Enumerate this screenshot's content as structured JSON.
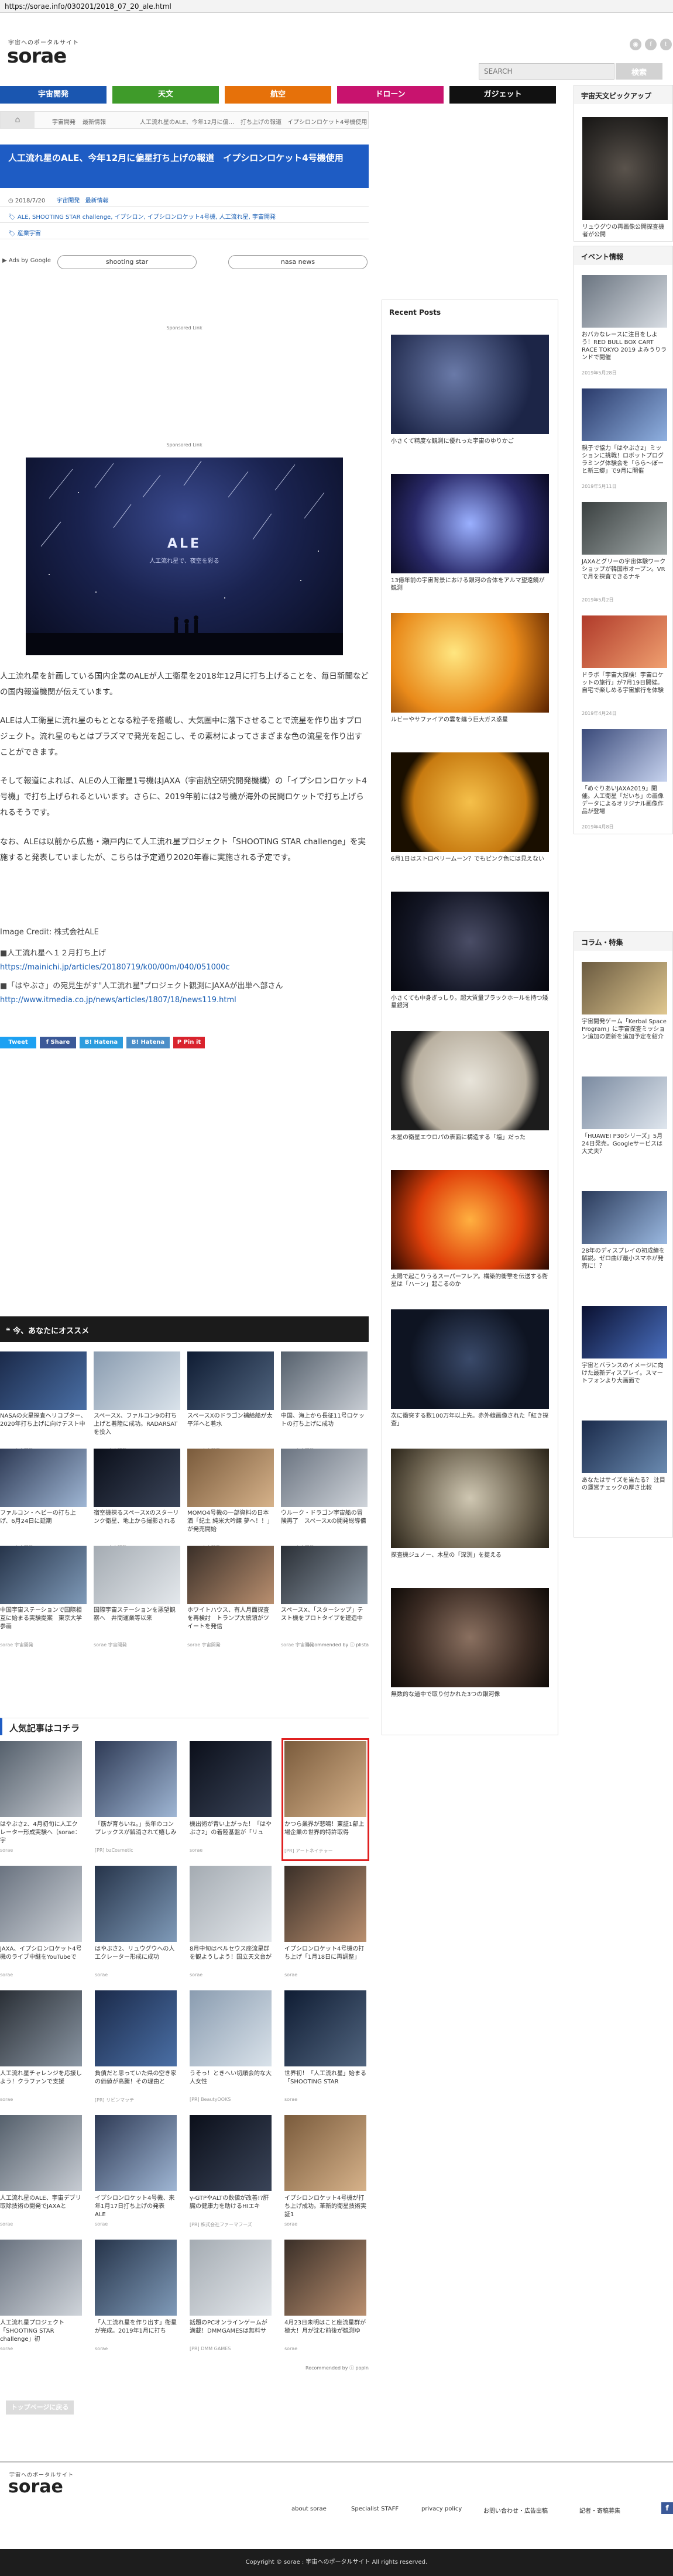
{
  "url": "https://sorae.info/030201/2018_07_20_ale.html",
  "header": {
    "logo_sub": "宇宙へのポータルサイト",
    "logo": "sorae",
    "search_placeholder": "SEARCH",
    "search_button": "検索"
  },
  "nav": {
    "tabs": [
      {
        "label": "宇宙開発",
        "color": "#1a56b0"
      },
      {
        "label": "天文",
        "color": "#3f9b2a"
      },
      {
        "label": "航空",
        "color": "#e6710a"
      },
      {
        "label": "ドローン",
        "color": "#c8136e"
      },
      {
        "label": "ガジェット",
        "color": "#111111"
      }
    ]
  },
  "breadcrumb": {
    "home": "⌂",
    "items": [
      "宇宙開発",
      "最新情報",
      "人工流れ星のALE、今年12月に偏…",
      "打ち上げの報道　イプシロンロケット4号機使用"
    ]
  },
  "article": {
    "title": "人工流れ星のALE、今年12月に偏星打ち上げの報道　イプシロンロケット4号機使用",
    "date": "2018/7/20",
    "categories": [
      "宇宙開発",
      "最新情報"
    ],
    "tags": [
      "ALE",
      "SHOOTING STAR challenge",
      "イプシロン",
      "イプシロンロケット4号機",
      "人工流れ星",
      "宇宙開発"
    ],
    "tag_extra": "産業宇宙",
    "ads_by_google": "Ads by Google",
    "ad_pills": [
      "shooting star",
      "nasa news"
    ],
    "sponsored": "Sponsored Link",
    "hero_title": "ALE",
    "hero_sub": "人工流れ星で、夜空を彩る",
    "paragraphs": {
      "p1": "人工流れ星を計画している国内企業のALEが人工衛星を2018年12月に打ち上げることを、毎日新聞などの国内報道機関が伝えています。",
      "p2": "ALEは人工衛星に流れ星のもととなる粒子を搭載し、大気圏中に落下させることで流星を作り出すプロジェクト。流れ星のもとはプラズマで発光を起こし、その素材によってさまざまな色の流星を作り出すことができます。",
      "p3": "そして報道によれば、ALEの人工衛星1号機はJAXA（宇宙航空研究開発機構）の「イプシロンロケット4号機」で打ち上げられるといいます。さらに、2019年前には2号機が海外の民間ロケットで打ち上げられるそうです。",
      "p4": "なお、ALEは以前から広島・瀬戸内にて人工流れ星プロジェクト「SHOOTING STAR challenge」を実施すると発表していましたが、こちらは予定通り2020年春に実施される予定です。"
    },
    "credit": "Image Credit: 株式会社ALE",
    "source_lines": [
      "■人工流れ星へ１２月打ち上げ",
      "https://mainichi.jp/articles/20180719/k00/00m/040/051000c",
      "■「はやぶさ」の宛見生がす\"人工流れ星\"プロジェクト観測にJAXAが出単へ部さん",
      "http://www.itmedia.co.jp/news/articles/1807/18/news119.html"
    ],
    "share": [
      {
        "label": "Tweet",
        "color": "#1da1f2"
      },
      {
        "label": "f Share",
        "color": "#3b5998"
      },
      {
        "label": "B! Hatena",
        "color": "#2c9cde"
      },
      {
        "label": "B! Hatena",
        "color": "#4b8ec8"
      },
      {
        "label": "P Pin it",
        "color": "#d9232d"
      }
    ]
  },
  "recommend": {
    "title": "今、あなたにオススメ",
    "items": [
      {
        "caption": "NASAの火星探査ヘリコプター、2020年打ち上げに向けテスト中",
        "source": "sorae 宇宙開発"
      },
      {
        "caption": "スペースX、ファルコン9の打ち上げと着陸に成功。RADARSATを投入",
        "source": "sorae 宇宙開発"
      },
      {
        "caption": "スペースXのドラゴン補給船が太平洋へと着水",
        "source": "sorae 宇宙開発"
      },
      {
        "caption": "中国、海上から長征11号ロケットの打ち上げに成功",
        "source": "sorae 宇宙開発"
      },
      {
        "caption": "ファルコン・ヘビーの打ち上げ、6月24日に延期",
        "source": "sorae 宇宙開発"
      },
      {
        "caption": "宿空機探るスペースXのスターリンク衛星、地上から撮影される",
        "source": "sorae 宇宙開発"
      },
      {
        "caption": "MOMO4号機の一部資料の日本酒「紀土 純米大吟醸 夢ヘ！！」が発売開始",
        "source": "sorae 宇宙開発"
      },
      {
        "caption": "ウルーク・ドラゴン宇宙船の冒険再了　スペースXの開発総導備",
        "source": "sorae 宇宙開発"
      },
      {
        "caption": "中国宇宙ステーションで国際相互に始まる実験提案　東京大学参画",
        "source": "sorae 宇宙開発"
      },
      {
        "caption": "国際宇宙ステーションを悪望観察へ　井間運業等以来",
        "source": "sorae 宇宙開発"
      },
      {
        "caption": "ホワイトハウス、有人月面探査を再検討　トランプ大統領がツイートを発信",
        "source": "sorae 宇宙開発"
      },
      {
        "caption": "スペースX、「スターシップ」テスト機をプロトタイプを建造中",
        "source": "sorae 宇宙開発"
      }
    ],
    "powered": "Recommended by ⓘ plista"
  },
  "popular": {
    "title": "人気記事はコチラ",
    "items": [
      {
        "caption": "はやぶさ2、4月初旬に人工クレーター形成実験へ（sorae：宇",
        "source": "sorae"
      },
      {
        "caption": "「筋が育ちいね。」長年のコンプレックスが解消されて嬉しみ",
        "source": "[PR] bzCosmetic"
      },
      {
        "caption": "機出術が青い上がった！「はやぶさ2」の着陸基盤が「リュ",
        "source": "sorae"
      },
      {
        "caption": "かつら業界が悲鳴！東証1部上場企業の世界的特許取得",
        "source": "[PR] アートネイチャー"
      },
      {
        "caption": "JAXA、イプシロンロケット4号機のライブ中継をYouTubeで",
        "source": "sorae"
      },
      {
        "caption": "はやぶさ2、リュウグウへの人工クレーター形成に成功",
        "source": "sorae"
      },
      {
        "caption": "8月中旬はペルセウス座流星群を観ようしよう！国立天文台が",
        "source": "sorae"
      },
      {
        "caption": "イプシロンロケット4号機の打ち上げ「1月18日に再調整」",
        "source": "sorae"
      },
      {
        "caption": "人工流れ星チャレンジを応援しよう！クラファンで支援",
        "source": "sorae"
      },
      {
        "caption": "負債だと思っていた県の空き家の価値が高騰！その理由と",
        "source": "[PR] リビンマッチ"
      },
      {
        "caption": "うそっ！ときへい切順会的な大人女性",
        "source": "[PR] BeautyOOKS"
      },
      {
        "caption": "世界初！「人工流れ星」始まる「SHOOTING STAR",
        "source": "sorae"
      },
      {
        "caption": "人工流れ星のALE、宇宙デブリ取除技術の開発でJAXAと",
        "source": "sorae"
      },
      {
        "caption": "イプシロンロケット4号機、来年1月17日打ち上げの発表 ALE",
        "source": "sorae"
      },
      {
        "caption": "γ-GTPやALTの数値が改善!?肝臓の健康力を助けるHIエキ",
        "source": "[PR] 株式会社ファーマフーズ"
      },
      {
        "caption": "イプシロンロケット4号機が打ち上げ成功。革新的衛星技術実証1",
        "source": "sorae"
      },
      {
        "caption": "人工流れ星プロジェクト「SHOOTING STAR challenge」初",
        "source": "sorae"
      },
      {
        "caption": "「人工流れ星を作り出す」衛星が完成。2019年1月に打ち",
        "source": "sorae"
      },
      {
        "caption": "話題のPCオンラインゲームが満載！DMMGAMESは無料サ",
        "source": "[PR] DMM GAMES"
      },
      {
        "caption": "4月23日未明はこと座流星群が極大！月が沈む前後が観測ゆ",
        "source": "sorae"
      }
    ],
    "powered": "Recommended by ⓘ popIn"
  },
  "back_to_top": "トップページに戻る",
  "sidebar_mid": {
    "title": "Recent Posts",
    "items": [
      {
        "caption": "小さくて精度な観測に優れった宇宙のゆりかご"
      },
      {
        "caption": "13億年前の宇宙背景における銀河の合体をアルマ望遠鏡が観測"
      },
      {
        "caption": "ルビーやサファイアの雲を纏う巨大ガス惑星"
      },
      {
        "caption": "6月1日はストロベリームーン？でもピンク色には見えない"
      },
      {
        "caption": "小さくても中身ぎっしり。超大質量ブラックホールを持つ矮星銀河"
      },
      {
        "caption": "木星の衛星エウロパの表面に構造する「塩」だった"
      },
      {
        "caption": "太陽で起こりうるスーパーフレア。構築的衝撃を伝送する衛星は「ハーン」起こるのか"
      },
      {
        "caption": "次に衝突する数100万年以上先。赤外線画像された「紅き探查」"
      },
      {
        "caption": "探査機ジュノー、木星の「深渕」を捉える"
      },
      {
        "caption": "無数的な過中で取り付かれた3つの銀河像"
      }
    ]
  },
  "sidebar_right": {
    "pickup_title": "宇宙天文ピックアップ",
    "pickup_caption": "リュウグウの再画像公開探査機者が公開",
    "events_title": "イベント情報",
    "events": [
      {
        "caption": "おバカなレースに注目をしよう！RED BULL BOX CART RACE TOKYO 2019 よみうりランドで開催",
        "date": "2019年5月28日"
      },
      {
        "caption": "親子で協力「はやぶさ2」ミッションに挑戦！ロボットプログラミング体験会を「らら～ぽーと新三郷」で9月に開催",
        "date": "2019年5月11日"
      },
      {
        "caption": "JAXAとグリーの宇宙体験ワークショップが韓国市オープン。VRで月を探査できるナキ",
        "date": "2019年5月2日"
      },
      {
        "caption": "ドラボ「宇宙大探検！宇宙ロケットの旅行」が7月19日開催。自宅で楽しめる宇宙旅行を体験",
        "date": "2019年4月24日"
      },
      {
        "caption": "「めぐりあいJAXA2019」開催。人工衛星「だいち」の画像データによるオリジナル画像作品が登場",
        "date": "2019年4月8日"
      }
    ],
    "column_title": "コラム・特集",
    "columns": [
      {
        "caption": "宇宙開発ゲーム「Kerbal Space Program」に宇宙探査ミッション追加の更新を追加予定を紹介"
      },
      {
        "caption": "「HUAWEI P30シリーズ」5月24日発売。Googleサービスは大丈夫？"
      },
      {
        "caption": "28年のディスプレイの初成績を解説。ゼロ曲げ最小スマホが発売に！？"
      },
      {
        "caption": "宇宙とバランスのイメージに向けた最新ディスプレイ。スマートフォンより大画面で"
      },
      {
        "caption": "あなたはサイズを当たる？ 注目の運営チェックの厚さ比較"
      }
    ]
  },
  "footer": {
    "logo_sub": "宇宙へのポータルサイト",
    "logo": "sorae",
    "links": [
      "about sorae",
      "Specialist STAFF",
      "privacy policy",
      "お問い合わせ・広告出稿",
      "記者・寄稿募集"
    ],
    "copyright": "Copyright © sorae : 宇宙へのポータルサイト All rights reserved."
  }
}
